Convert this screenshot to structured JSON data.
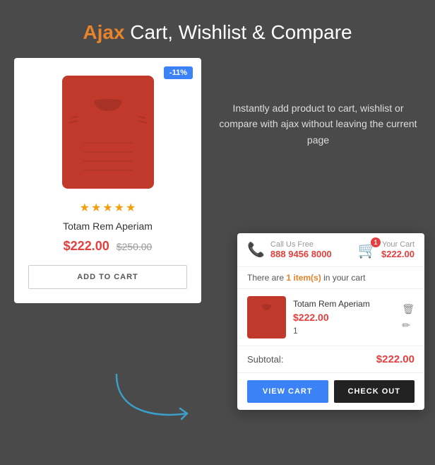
{
  "header": {
    "title_prefix": "Ajax",
    "title_suffix": " Cart, Wishlist & Compare"
  },
  "description": {
    "text": "Instantly add product to cart, wishlist or compare with ajax without leaving the current page"
  },
  "product": {
    "discount": "-11%",
    "name": "Totam Rem Aperiam",
    "current_price": "$222.00",
    "original_price": "$250.00",
    "stars": 5,
    "add_to_cart_label": "ADD TO CART"
  },
  "cart": {
    "call_us_label": "Call Us Free",
    "phone_number": "888 9456 8000",
    "your_cart_label": "Your Cart",
    "total_price": "$222.00",
    "badge_count": "1",
    "info_bar_prefix": "There are",
    "info_bar_item_count": "1 item(s)",
    "info_bar_suffix": "in your cart",
    "item": {
      "name": "Totam Rem Aperiam",
      "price": "$222.00",
      "qty": "1"
    },
    "subtotal_label": "Subtotal:",
    "subtotal_amount": "$222.00",
    "view_cart_label": "VIEW CART",
    "checkout_label": "CHECK OUT"
  }
}
